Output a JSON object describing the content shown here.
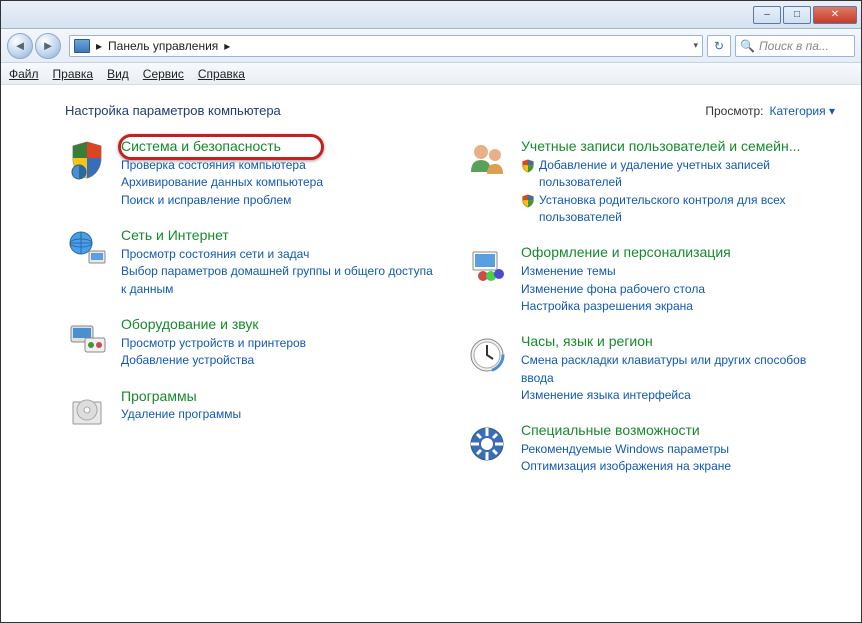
{
  "titlebar": {
    "min": "–",
    "max": "□",
    "close": "✕"
  },
  "nav": {
    "back": "◄",
    "fwd": "►",
    "breadcrumb_icon": "cp",
    "breadcrumb_sep": "▸",
    "breadcrumb": "Панель управления",
    "refresh": "↻",
    "search_placeholder": "Поиск в па...",
    "search_icon": "🔍"
  },
  "menu": {
    "file": "Файл",
    "edit": "Правка",
    "view": "Вид",
    "tools": "Сервис",
    "help": "Справка"
  },
  "header": {
    "title": "Настройка параметров компьютера",
    "viewby_label": "Просмотр:",
    "viewby_value": "Категория",
    "caret": "▾"
  },
  "left": [
    {
      "icon": "shield-security",
      "title": "Система и безопасность",
      "links": [
        {
          "t": "Проверка состояния компьютера"
        },
        {
          "t": "Архивирование данных компьютера"
        },
        {
          "t": "Поиск и исправление проблем"
        }
      ],
      "hl": true
    },
    {
      "icon": "network",
      "title": "Сеть и Интернет",
      "links": [
        {
          "t": "Просмотр состояния сети и задач"
        },
        {
          "t": "Выбор параметров домашней группы и общего доступа к данным"
        }
      ]
    },
    {
      "icon": "hardware",
      "title": "Оборудование и звук",
      "links": [
        {
          "t": "Просмотр устройств и принтеров"
        },
        {
          "t": "Добавление устройства"
        }
      ]
    },
    {
      "icon": "programs",
      "title": "Программы",
      "links": [
        {
          "t": "Удаление программы"
        }
      ]
    }
  ],
  "right": [
    {
      "icon": "users",
      "title": "Учетные записи пользователей и семейн...",
      "links": [
        {
          "t": "Добавление и удаление учетных записей пользователей",
          "s": true
        },
        {
          "t": "Установка родительского контроля для всех пользователей",
          "s": true
        }
      ]
    },
    {
      "icon": "appearance",
      "title": "Оформление и персонализация",
      "links": [
        {
          "t": "Изменение темы"
        },
        {
          "t": "Изменение фона рабочего стола"
        },
        {
          "t": "Настройка разрешения экрана"
        }
      ]
    },
    {
      "icon": "clock",
      "title": "Часы, язык и регион",
      "links": [
        {
          "t": "Смена раскладки клавиатуры или других способов ввода"
        },
        {
          "t": "Изменение языка интерфейса"
        }
      ]
    },
    {
      "icon": "ease",
      "title": "Специальные возможности",
      "links": [
        {
          "t": "Рекомендуемые Windows параметры"
        },
        {
          "t": "Оптимизация изображения на экране"
        }
      ]
    }
  ]
}
